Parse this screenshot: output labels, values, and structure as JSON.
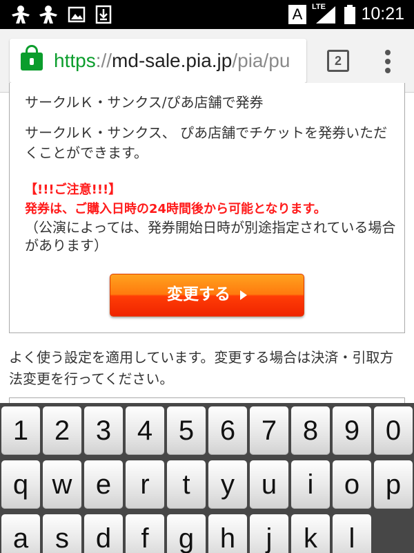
{
  "status_bar": {
    "time": "10:21",
    "network": "LTE",
    "input_indicator": "A",
    "icons": [
      "notification-icon",
      "notification-icon",
      "image-icon",
      "download-icon",
      "signal-icon",
      "battery-icon"
    ]
  },
  "browser": {
    "url_scheme": "https",
    "url_separator": "://",
    "url_host": "md-sale.pia.jp",
    "url_path": "/pia/pu",
    "tab_count": "2"
  },
  "content": {
    "section_title": "サークルＫ・サンクス/ぴあ店舗で発券",
    "description": "サークルＫ・サンクス、 ぴあ店舗でチケットを発券いただくことができます。",
    "warning_heading": "【!!!ご注意!!!】",
    "warning_text": "発券は、ご購入日時の24時間後から可能となります。",
    "note": "（公演によっては、発券開始日時が別途指定されている場合があります）",
    "change_button": "変更する",
    "info_text": "よく使う設定を適用しています。変更する場合は決済・引取方法変更を行ってください。"
  },
  "keyboard": {
    "row1": [
      "1",
      "2",
      "3",
      "4",
      "5",
      "6",
      "7",
      "8",
      "9",
      "0"
    ],
    "row2": [
      "q",
      "w",
      "e",
      "r",
      "t",
      "y",
      "u",
      "i",
      "o",
      "p"
    ],
    "row3": [
      "a",
      "s",
      "d",
      "f",
      "g",
      "h",
      "j",
      "k",
      "l"
    ]
  },
  "colors": {
    "secure_green": "#0b9d2c",
    "warning_red": "#ff1a1a",
    "button_orange": "#ff7a0e"
  }
}
